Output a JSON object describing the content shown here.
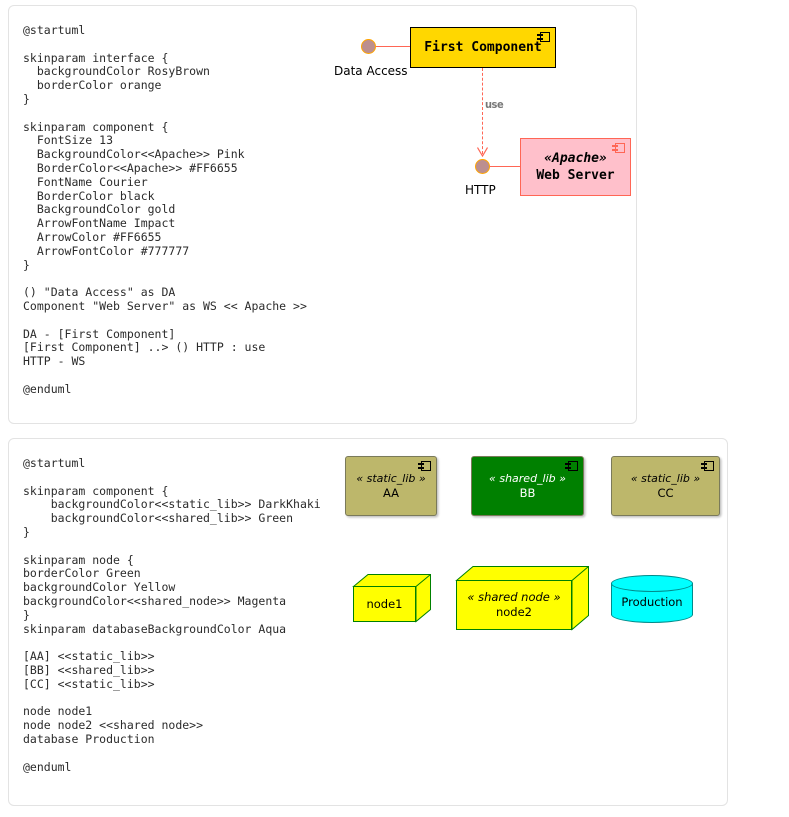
{
  "panels": [
    {
      "id": "panel-1",
      "code": "@startuml\n\nskinparam interface {\n  backgroundColor RosyBrown\n  borderColor orange\n}\n\nskinparam component {\n  FontSize 13\n  BackgroundColor<<Apache>> Pink\n  BorderColor<<Apache>> #FF6655\n  FontName Courier\n  BorderColor black\n  BackgroundColor gold\n  ArrowFontName Impact\n  ArrowColor #FF6655\n  ArrowFontColor #777777\n}\n\n() \"Data Access\" as DA\nComponent \"Web Server\" as WS << Apache >>\n\nDA - [First Component]\n[First Component] ..> () HTTP : use\nHTTP - WS\n\n@enduml"
    },
    {
      "id": "panel-2",
      "code": "@startuml\n\nskinparam component {\n    backgroundColor<<static_lib>> DarkKhaki\n    backgroundColor<<shared_lib>> Green\n}\n\nskinparam node {\nborderColor Green\nbackgroundColor Yellow\nbackgroundColor<<shared_node>> Magenta\n}\nskinparam databaseBackgroundColor Aqua\n\n[AA] <<static_lib>>\n[BB] <<shared_lib>>\n[CC] <<static_lib>>\n\nnode node1\nnode node2 <<shared node>>\ndatabase Production\n\n@enduml"
    }
  ],
  "diagram1": {
    "first_component": {
      "name": "First Component"
    },
    "web_server": {
      "stereotype": "«Apache»",
      "name": "Web Server"
    },
    "interface_data_access": {
      "label": "Data Access"
    },
    "interface_http": {
      "label": "HTTP"
    },
    "edge_use": {
      "label": "use"
    },
    "colors": {
      "component_background": "#FFD700",
      "component_border": "#000000",
      "apache_background": "#FFC0CB",
      "apache_border": "#FF6655",
      "interface_background": "#BC8F8F",
      "interface_border": "#FFA500",
      "arrow_color": "#FF6655",
      "arrow_font_color": "#777777"
    }
  },
  "diagram2": {
    "components": [
      {
        "stereotype": "« static_lib »",
        "name": "AA",
        "color": "#BDB76B"
      },
      {
        "stereotype": "« shared_lib »",
        "name": "BB",
        "color": "#008000"
      },
      {
        "stereotype": "« static_lib »",
        "name": "CC",
        "color": "#BDB76B"
      }
    ],
    "nodes": [
      {
        "stereotype": "",
        "name": "node1",
        "color": "#FFFF00",
        "border": "#008000"
      },
      {
        "stereotype": "« shared node »",
        "name": "node2",
        "color": "#FFFF00",
        "border": "#008000"
      }
    ],
    "database": {
      "name": "Production",
      "color": "#00FFFF"
    }
  }
}
